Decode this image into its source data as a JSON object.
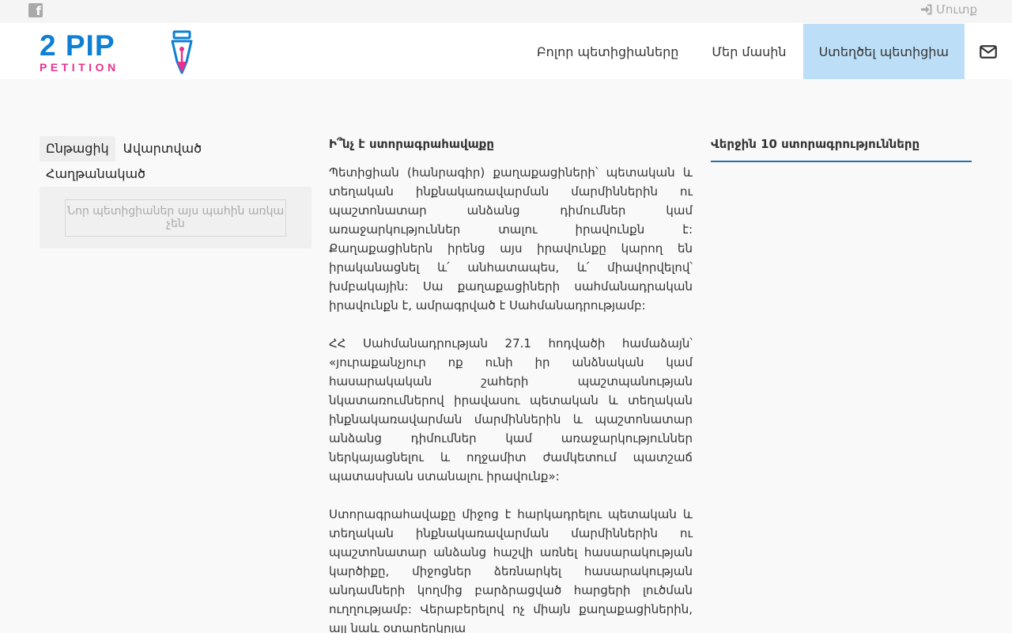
{
  "topbar": {
    "social_icon": "facebook-icon",
    "login_icon": "sign-in-icon",
    "login_label": "Մուտք"
  },
  "header": {
    "logo_top": "2 PIP",
    "logo_bottom": "PETITION",
    "nav": {
      "all_petitions": "Բոլոր պետիցիաները",
      "about": "Մեր մասին",
      "create_petition": "Ստեղծել պետիցիա",
      "mail_icon": "envelope-icon"
    },
    "colors": {
      "brand_blue": "#0d7fd5",
      "brand_pink": "#e8308c",
      "active_nav": "#bcdff7"
    }
  },
  "sidebar": {
    "tabs": [
      "Ընթացիկ",
      "Ավարտված",
      "Հաղթանակած"
    ],
    "selected_tab": "Ընթացիկ",
    "empty_notice": "Նոր պետիցիաներ այս պահին առկա չեն"
  },
  "content": {
    "title": "Ի՞նչ է ստորագրահավաքը",
    "paragraphs": [
      "Պետիցիան (հանրագիր) քաղաքացիների՝ պետական և տեղական ինքնակառավարման մարմիններին ու պաշտոնատար անձանց դիմումներ կամ առաջարկություններ տալու իրավունքն է: Քաղաքացիներն իրենց այս իրավունքը կարող են իրականացնել և՛ անհատապես, և՛ միավորվելով՝ խմբակային: Սա քաղաքացիների սահմանադրական իրավունքն է, ամրագրված է Սահմանադրությամբ:",
      "ՀՀ Սահմանադրության 27.1 հոդվածի համաձայն՝ «յուրաքանչյուր ոք ունի իր անձնական կամ հասարակական շահերի պաշտպանության նկատառումներով իրավասու պետական և տեղական ինքնակառավարման մարմիններին և պաշտոնատար անձանց դիմումներ կամ առաջարկություններ ներկայացնելու և ողջամիտ ժամկետում պատշաճ պատասխան ստանալու իրավունք»:",
      "Ստորագրահավաքը միջոց է հարկադրելու պետական և տեղական ինքնակառավարման մարմիններին ու պաշտոնատար անձանց հաշվի առնել հասարակության կարծիքը, միջոցներ ձեռնարկել հասարակության անդամների կողմից բարձրացված հարցերի լուծման ուղղությամբ: Վերաբերելով ոչ միայն քաղաքացիներին, այլ նաև օտարերկրյա"
    ]
  },
  "right": {
    "title": "Վերջին 10 ստորագրությունները"
  }
}
